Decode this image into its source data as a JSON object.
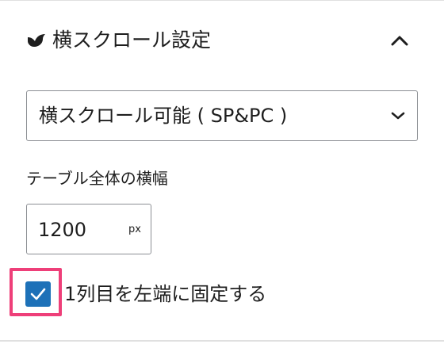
{
  "panel": {
    "title": "横スクロール設定",
    "header_icon": "bird-icon",
    "collapse_icon": "chevron-up-icon"
  },
  "scroll_select": {
    "selected": "横スクロール可能 ( SP&PC )",
    "icon": "chevron-down-icon"
  },
  "table_width": {
    "label": "テーブル全体の横幅",
    "value": "1200",
    "unit": "px"
  },
  "fix_first_column": {
    "label": "1列目を左端に固定する",
    "checked": true
  },
  "colors": {
    "accent": "#1d71b8",
    "highlight": "#ee3f79",
    "border": "#8c8f94",
    "divider": "#e0e0e0",
    "text": "#1e1e1e"
  }
}
